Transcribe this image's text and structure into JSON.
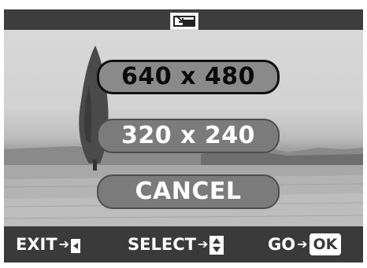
{
  "header": {
    "icon": "resize-icon"
  },
  "menu": {
    "options": [
      {
        "label": "640 x 480",
        "selected": true
      },
      {
        "label": "320 x 240",
        "selected": false
      },
      {
        "label": "CANCEL",
        "selected": false
      }
    ]
  },
  "footer": {
    "exit_label": "EXIT",
    "exit_key_icon": "back-key-icon",
    "select_label": "SELECT",
    "select_key_icon": "up-down-key-icon",
    "go_label": "GO",
    "go_key_label": "OK",
    "arrow_icon": "right-arrow-icon"
  },
  "colors": {
    "frame": "#3a3a3a",
    "pill_fill": "#7b7b7b",
    "selected_border": "#111111",
    "text": "#ffffff"
  }
}
